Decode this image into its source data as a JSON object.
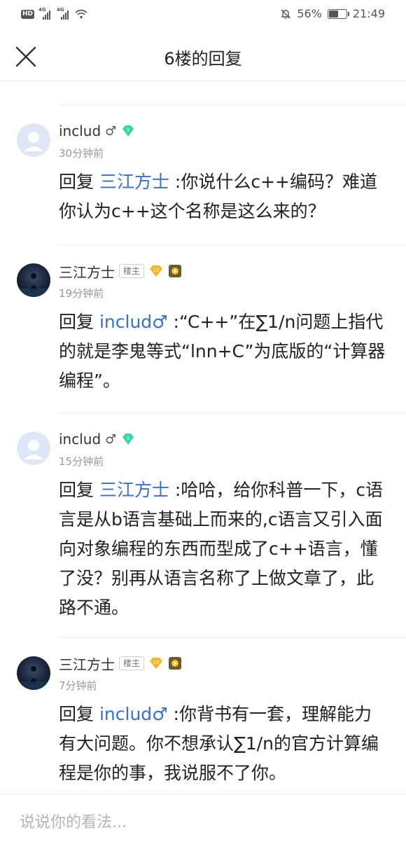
{
  "status_bar": {
    "hd_label": "HD",
    "net1": "4G",
    "net2": "4G",
    "battery_percent": "56%",
    "battery_level": 0.56,
    "time": "21:49"
  },
  "header": {
    "title": "6楼的回复",
    "close_icon": "close-icon"
  },
  "replies": [
    {
      "username": "includ",
      "gender_symbol": "♂",
      "time": "30分钟前",
      "reply_prefix": "回复",
      "mention": "三江方士",
      "mention_symbol": "",
      "content": " :你说什么c++编码？难道你认为c++这个名称是这么来的？"
    },
    {
      "username": "三江方士",
      "badge": "楼主",
      "level": "12",
      "time": "19分钟前",
      "reply_prefix": "回复",
      "mention": "includ",
      "mention_symbol": "♂",
      "content": " :“C++”在∑1/n问题上指代的就是李鬼等式“lnn+C”为底版的“计算器编程”。"
    },
    {
      "username": "includ",
      "gender_symbol": "♂",
      "time": "15分钟前",
      "reply_prefix": "回复",
      "mention": "三江方士",
      "mention_symbol": "",
      "content": " :哈哈，给你科普一下，c语言是从b语言基础上而来的,c语言又引入面向对象编程的东西而型成了c++语言，懂了没？别再从语言名称了上做文章了，此路不通。"
    },
    {
      "username": "三江方士",
      "badge": "楼主",
      "level": "12",
      "time": "7分钟前",
      "reply_prefix": "回复",
      "mention": "includ",
      "mention_symbol": "♂",
      "content": " :你背书有一套，理解能力有大问题。你不想承认∑1/n的官方计算编程是你的事，我说服不了你。"
    }
  ],
  "input": {
    "placeholder": "说说你的看法..."
  },
  "colors": {
    "mention": "#3b6fc6",
    "gem": "#3dd6a6",
    "level_badge": "#f5b52a",
    "sun_badge": "#f2c230"
  }
}
